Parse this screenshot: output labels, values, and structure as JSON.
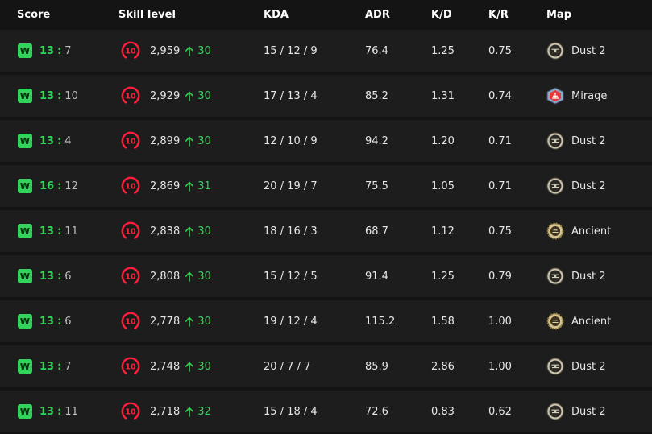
{
  "header": {
    "score": "Score",
    "skill_level": "Skill level",
    "kda": "KDA",
    "adr": "ADR",
    "kd": "K/D",
    "kr": "K/R",
    "map": "Map"
  },
  "colors": {
    "win": "#32d35a",
    "level_ring": "#ff1f3d",
    "row_bg": "#1d1d1d",
    "page_bg": "#141414"
  },
  "matches": [
    {
      "result": "W",
      "own": "13",
      "sep": ":",
      "opp": "7",
      "level": "10",
      "elo": "2,959",
      "change": "30",
      "kda": "15 / 12 / 9",
      "adr": "76.4",
      "kd": "1.25",
      "kr": "0.75",
      "map": "Dust 2",
      "map_icon": "dust2-icon"
    },
    {
      "result": "W",
      "own": "13",
      "sep": ":",
      "opp": "10",
      "level": "10",
      "elo": "2,929",
      "change": "30",
      "kda": "17 / 13 / 4",
      "adr": "85.2",
      "kd": "1.31",
      "kr": "0.74",
      "map": "Mirage",
      "map_icon": "mirage-icon"
    },
    {
      "result": "W",
      "own": "13",
      "sep": ":",
      "opp": "4",
      "level": "10",
      "elo": "2,899",
      "change": "30",
      "kda": "12 / 10 / 9",
      "adr": "94.2",
      "kd": "1.20",
      "kr": "0.71",
      "map": "Dust 2",
      "map_icon": "dust2-icon"
    },
    {
      "result": "W",
      "own": "16",
      "sep": ":",
      "opp": "12",
      "level": "10",
      "elo": "2,869",
      "change": "31",
      "kda": "20 / 19 / 7",
      "adr": "75.5",
      "kd": "1.05",
      "kr": "0.71",
      "map": "Dust 2",
      "map_icon": "dust2-icon"
    },
    {
      "result": "W",
      "own": "13",
      "sep": ":",
      "opp": "11",
      "level": "10",
      "elo": "2,838",
      "change": "30",
      "kda": "18 / 16 / 3",
      "adr": "68.7",
      "kd": "1.12",
      "kr": "0.75",
      "map": "Ancient",
      "map_icon": "ancient-icon"
    },
    {
      "result": "W",
      "own": "13",
      "sep": ":",
      "opp": "6",
      "level": "10",
      "elo": "2,808",
      "change": "30",
      "kda": "15 / 12 / 5",
      "adr": "91.4",
      "kd": "1.25",
      "kr": "0.79",
      "map": "Dust 2",
      "map_icon": "dust2-icon"
    },
    {
      "result": "W",
      "own": "13",
      "sep": ":",
      "opp": "6",
      "level": "10",
      "elo": "2,778",
      "change": "30",
      "kda": "19 / 12 / 4",
      "adr": "115.2",
      "kd": "1.58",
      "kr": "1.00",
      "map": "Ancient",
      "map_icon": "ancient-icon"
    },
    {
      "result": "W",
      "own": "13",
      "sep": ":",
      "opp": "7",
      "level": "10",
      "elo": "2,748",
      "change": "30",
      "kda": "20 / 7 / 7",
      "adr": "85.9",
      "kd": "2.86",
      "kr": "1.00",
      "map": "Dust 2",
      "map_icon": "dust2-icon"
    },
    {
      "result": "W",
      "own": "13",
      "sep": ":",
      "opp": "11",
      "level": "10",
      "elo": "2,718",
      "change": "32",
      "kda": "15 / 18 / 4",
      "adr": "72.6",
      "kd": "0.83",
      "kr": "0.62",
      "map": "Dust 2",
      "map_icon": "dust2-icon"
    }
  ]
}
